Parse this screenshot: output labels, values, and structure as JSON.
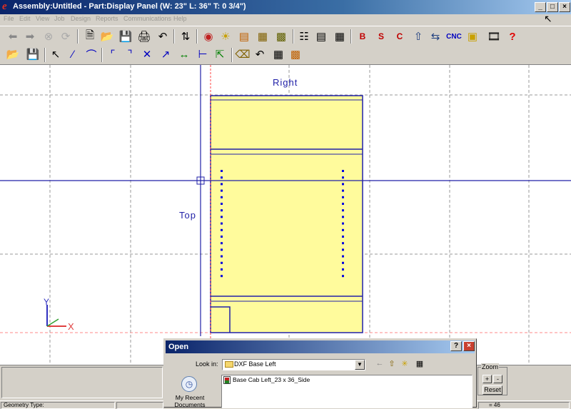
{
  "window": {
    "title": "Assembly:Untitled - Part:Display Panel (W: 23\"  L: 36\"  T: 0 3/4\")",
    "controls": {
      "minimize": "_",
      "maximize": "□",
      "close": "×"
    }
  },
  "menu": [
    "File",
    "Edit",
    "View",
    "Job",
    "Design",
    "Reports",
    "Communications",
    "Help"
  ],
  "toolbar": {
    "cnc_label": "CNC",
    "help_label": "?"
  },
  "canvas": {
    "label_right": "Right",
    "label_top": "Top",
    "axis_x": "X",
    "axis_y": "Y",
    "colors": {
      "panel_fill": "#fffb9c",
      "panel_stroke": "#2121a8",
      "guide_red": "#ff4444",
      "grid": "#999999"
    }
  },
  "zoom": {
    "legend": "Zoom",
    "plus": "+",
    "minus": "-",
    "reset": "Reset"
  },
  "status": {
    "geometry_type": "Geometry Type:",
    "right_value": "= 46"
  },
  "open_dialog": {
    "title": "Open",
    "look_in_label": "Look in:",
    "look_in_value": "DXF Base Left",
    "files": [
      "Base Cab Left_23 x 36_Side"
    ],
    "places": [
      "My Recent Documents"
    ],
    "help": "?",
    "close": "×"
  }
}
